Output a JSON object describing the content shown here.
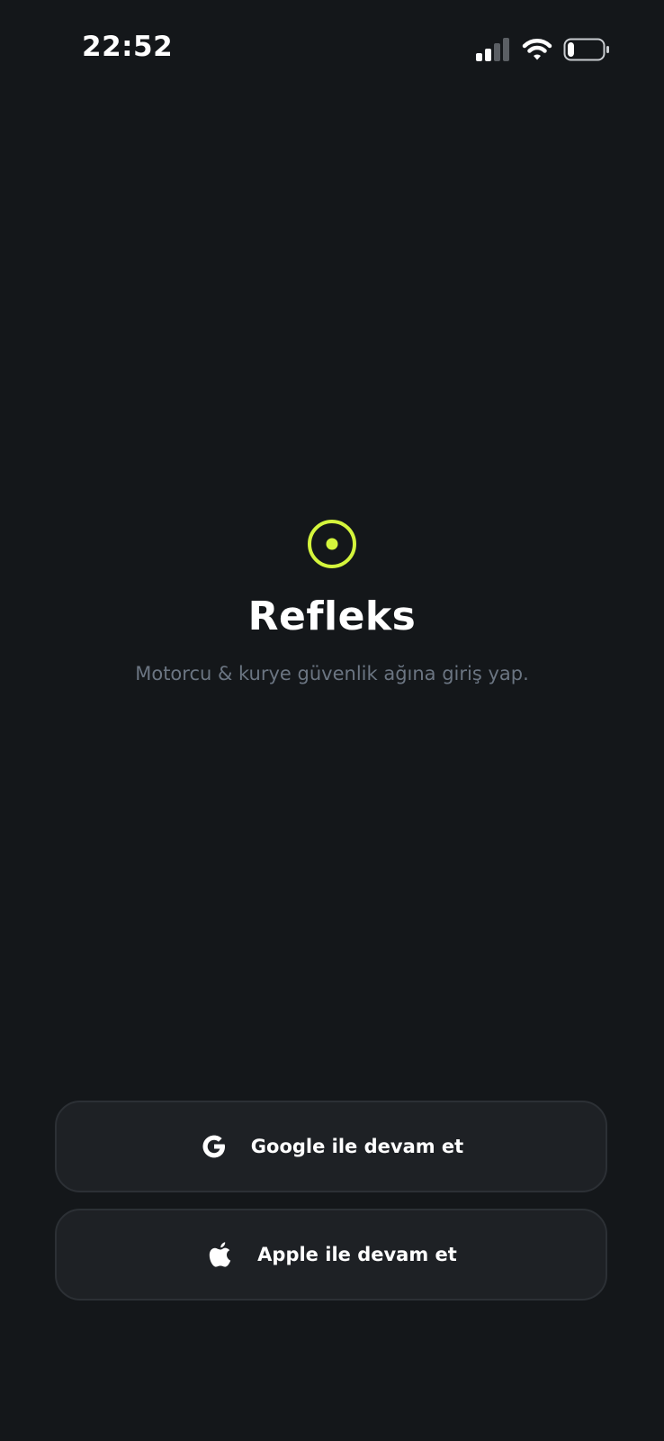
{
  "status_bar": {
    "time": "22:52",
    "icons": [
      "signal-icon",
      "wifi-icon",
      "battery-icon"
    ],
    "battery_level": 0.2
  },
  "brand": {
    "logo_icon": "target-dot-icon",
    "title": "Refleks",
    "subtitle": "Motorcu & kurye güvenlik ağına giriş yap."
  },
  "auth": {
    "google_label": "Google ile devam et",
    "google_icon": "google-icon",
    "apple_label": "Apple ile devam et",
    "apple_icon": "apple-icon"
  },
  "colors": {
    "background": "#14171a",
    "accent": "#d4f53c",
    "button_bg": "#1e2125",
    "button_border": "#2c3035",
    "subtitle": "#6b7582"
  }
}
